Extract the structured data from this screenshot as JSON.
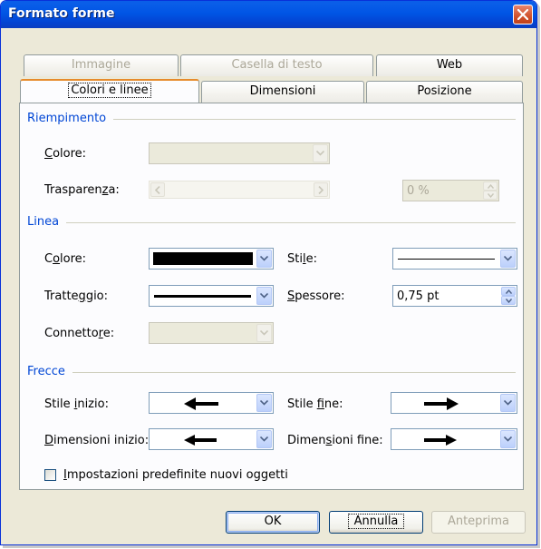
{
  "window": {
    "title": "Formato forme"
  },
  "tabs_top": [
    {
      "label": "Immagine",
      "enabled": false
    },
    {
      "label": "Casella di testo",
      "enabled": false
    },
    {
      "label": "Web",
      "enabled": true
    }
  ],
  "tabs_bottom": [
    {
      "label": "Colori e linee",
      "active": true
    },
    {
      "label": "Dimensioni",
      "active": false
    },
    {
      "label": "Posizione",
      "active": false
    }
  ],
  "fill": {
    "group_label": "Riempimento",
    "color_label": "Colore:",
    "color_label_accel": "C",
    "color_label_rest": "olore:",
    "transparency_label_pre": "Trasparen",
    "transparency_label_accel": "z",
    "transparency_label_post": "a:",
    "transparency_value": "0 %"
  },
  "line": {
    "group_label": "Linea",
    "color_label_pre": "C",
    "color_label_accel": "o",
    "color_label_post": "lore:",
    "color_value": "#000000",
    "style_label_pre": "Sti",
    "style_label_accel": "l",
    "style_label_post": "e:",
    "dash_label_pre": "Tratte",
    "dash_label_accel": "g",
    "dash_label_post": "gio:",
    "weight_label_pre": "",
    "weight_label_accel": "S",
    "weight_label_post": "pessore:",
    "weight_value": "0,75 pt",
    "connector_label_pre": "Connetto",
    "connector_label_accel": "r",
    "connector_label_post": "e:"
  },
  "arrows": {
    "group_label": "Frecce",
    "begin_style_pre": "Stile ",
    "begin_style_accel": "i",
    "begin_style_post": "nizio:",
    "end_style_pre": "Stile ",
    "end_style_accel": "f",
    "end_style_post": "ine:",
    "begin_size_pre": "",
    "begin_size_accel": "D",
    "begin_size_post": "imensioni inizio:",
    "end_size_pre": "Dimen",
    "end_size_accel": "s",
    "end_size_post": "ioni fine:"
  },
  "defaults_checkbox": {
    "accel": "I",
    "label_rest": "mpostazioni predefinite nuovi oggetti",
    "checked": false
  },
  "buttons": {
    "ok": "OK",
    "cancel": "Annulla",
    "preview": "Anteprima"
  }
}
